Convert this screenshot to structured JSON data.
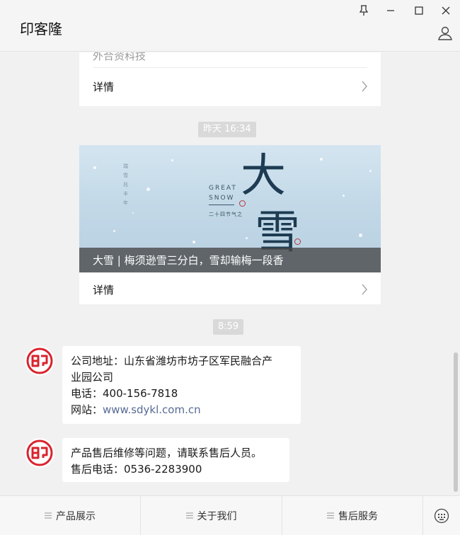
{
  "window": {
    "title": "印客隆"
  },
  "colors": {
    "accent_link": "#576b95",
    "logo_red": "#d9232e",
    "time_badge": "#d9d9d9"
  },
  "icons": {
    "pin": "pin-icon",
    "minimize": "minimize-icon",
    "maximize": "maximize-icon",
    "close": "close-icon",
    "user": "user-icon",
    "chevron": "chevron-right-icon",
    "menu": "hamburger-icon",
    "keyboard": "keyboard-icon"
  },
  "chat": {
    "article1": {
      "subtitle": "外合资科技",
      "detail_label": "详情"
    },
    "time1": "昨天 16:34",
    "article2": {
      "banner_big_chars": [
        "大",
        "雪"
      ],
      "banner_en_line1": "GREAT",
      "banner_en_line2": "SNOW",
      "banner_cn_small": "二十四节气之",
      "banner_vertical": "瑞雪兆丰年",
      "caption": "大雪 | 梅须逊雪三分白，雪却输梅一段香",
      "detail_label": "详情"
    },
    "time2": "8:59",
    "message1": {
      "line1": "公司地址：山东省潍坊市坊子区军民融合产",
      "line2": "业园公司",
      "line3": "电话：400-156-7818",
      "site_label": "网站：",
      "site_url": "www.sdykl.com.cn"
    },
    "message2": {
      "line1": "产品售后维修等问题，请联系售后人员。",
      "line2": "售后电话：0536-2283900"
    }
  },
  "menu": {
    "items": [
      {
        "label": "产品展示"
      },
      {
        "label": "关于我们"
      },
      {
        "label": "售后服务"
      }
    ]
  }
}
